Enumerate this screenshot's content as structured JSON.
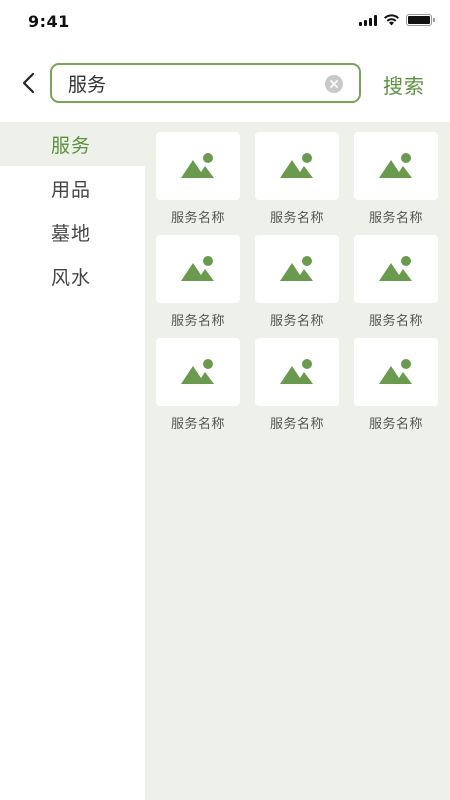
{
  "status_bar": {
    "time": "9:41",
    "icons": [
      "signal-icon",
      "wifi-icon",
      "battery-icon"
    ]
  },
  "header": {
    "back_icon": "chevron-left-icon",
    "search_value": "服务",
    "clear_icon": "clear-circle-icon",
    "search_button_label": "搜索"
  },
  "sidebar": {
    "items": [
      {
        "label": "服务",
        "active": true
      },
      {
        "label": "用品",
        "active": false
      },
      {
        "label": "墓地",
        "active": false
      },
      {
        "label": "风水",
        "active": false
      }
    ]
  },
  "grid": {
    "items": [
      {
        "label": "服务名称",
        "icon": "image-placeholder-icon"
      },
      {
        "label": "服务名称",
        "icon": "image-placeholder-icon"
      },
      {
        "label": "服务名称",
        "icon": "image-placeholder-icon"
      },
      {
        "label": "服务名称",
        "icon": "image-placeholder-icon"
      },
      {
        "label": "服务名称",
        "icon": "image-placeholder-icon"
      },
      {
        "label": "服务名称",
        "icon": "image-placeholder-icon"
      },
      {
        "label": "服务名称",
        "icon": "image-placeholder-icon"
      },
      {
        "label": "服务名称",
        "icon": "image-placeholder-icon"
      },
      {
        "label": "服务名称",
        "icon": "image-placeholder-icon"
      }
    ]
  },
  "colors": {
    "accent": "#5c9140",
    "panel_bg": "#edf1ea",
    "search_border": "#7aa35a",
    "icon_green": "#6a9a4e"
  }
}
